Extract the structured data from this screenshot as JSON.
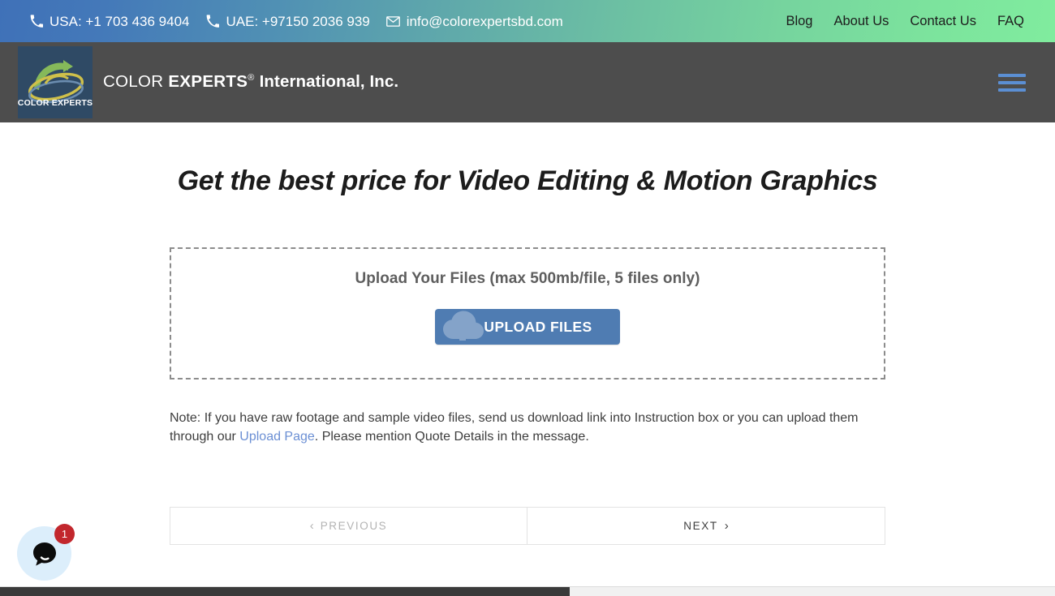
{
  "topbar": {
    "contacts": [
      {
        "icon": "phone-icon",
        "text": "USA: +1 703 436 9404"
      },
      {
        "icon": "phone-icon",
        "text": "UAE: +97150 2036 939"
      },
      {
        "icon": "envelope-icon",
        "text": "info@colorexpertsbd.com"
      }
    ],
    "nav": [
      {
        "label": "Blog"
      },
      {
        "label": "About Us"
      },
      {
        "label": "Contact Us"
      },
      {
        "label": "FAQ"
      }
    ],
    "gradient_from": "#3f71b8",
    "gradient_to": "#80ec9e"
  },
  "header": {
    "background": "#4d4d4d",
    "logo": {
      "mark_text": "COLOR EXPERTS",
      "mark_background": "#2f4a65",
      "wordmark_light": "COLOR ",
      "wordmark_bold": "EXPERTS",
      "wordmark_sup": "®",
      "wordmark_line2": "International, Inc."
    },
    "menu_icon": "hamburger-menu-icon",
    "menu_icon_color": "#5b8fd4"
  },
  "main": {
    "title": "Get the best price for Video Editing & Motion Graphics",
    "dropzone": {
      "title": "Upload Your Files (max 500mb/file, 5 files only)",
      "button_label": "UPLOAD FILES",
      "button_icon": "cloud-upload-icon",
      "button_color": "#4f7cb2"
    },
    "note": {
      "prefix": "Note: If you have raw footage and sample video files, send us download link into Instruction box or you can upload them through our ",
      "link_text": "Upload Page",
      "suffix": ". Please mention Quote Details in the message.",
      "link_color": "#6b8fd4"
    },
    "nav_buttons": {
      "previous_label": "PREVIOUS",
      "previous_chevron": "‹",
      "next_label": "NEXT",
      "next_chevron": "›"
    }
  },
  "chat": {
    "icon": "chat-bubble-icon",
    "badge_count": "1",
    "badge_color": "#c2272d",
    "circle_color": "#dceefb"
  }
}
